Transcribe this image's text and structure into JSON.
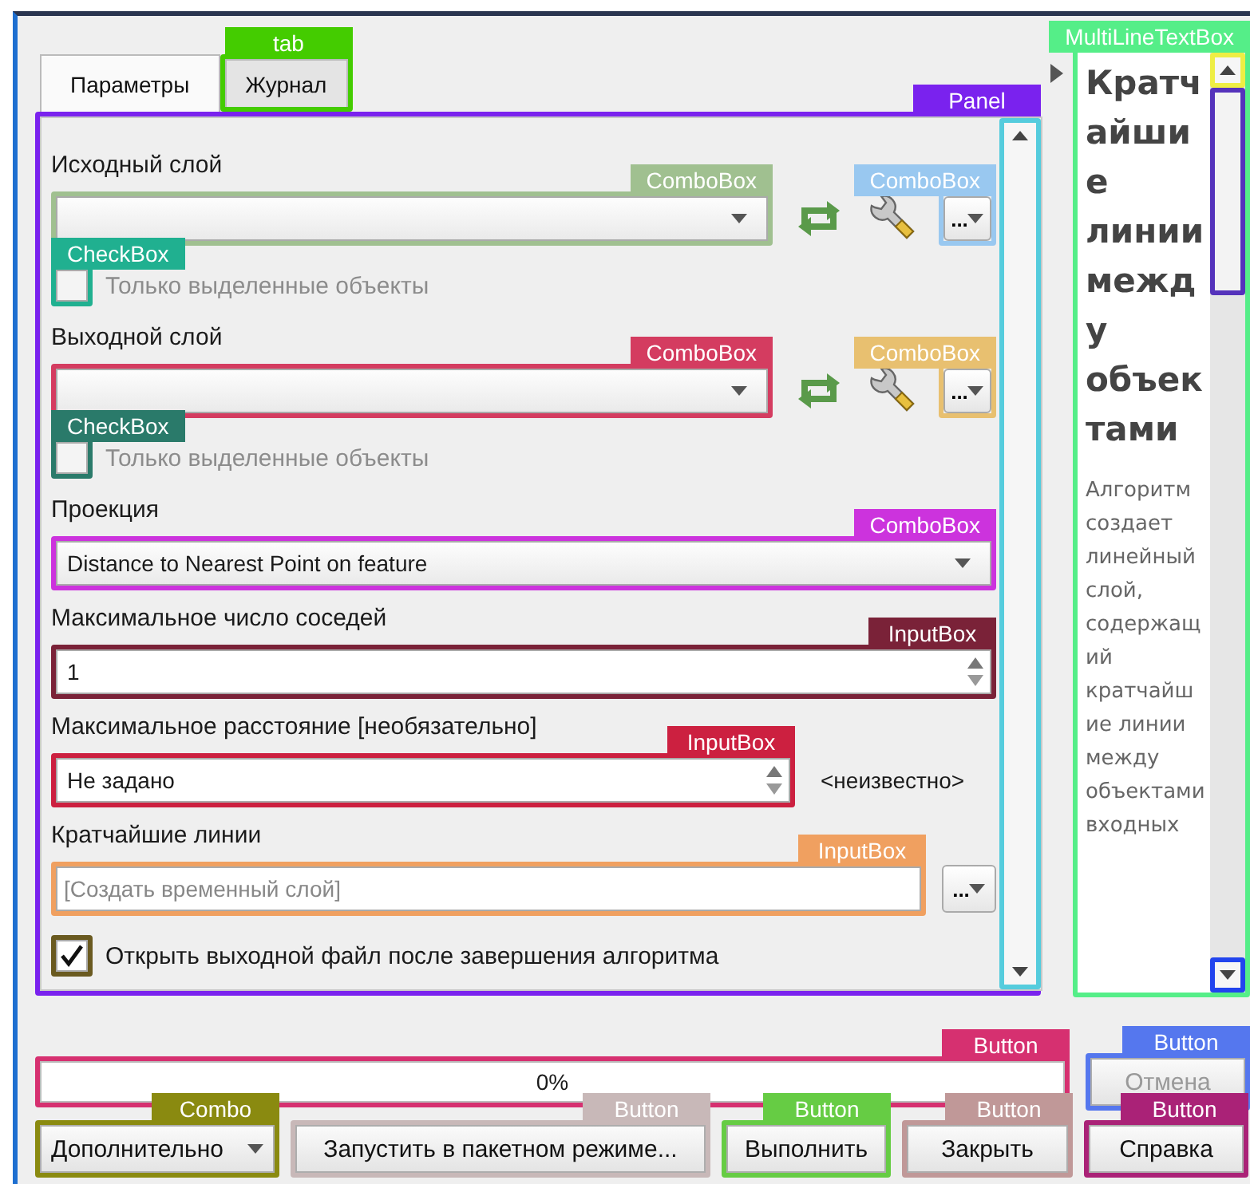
{
  "tabs": [
    {
      "label": "Параметры",
      "selected": true
    },
    {
      "label": "Журнал",
      "selected": false,
      "annotation": {
        "label": "tab",
        "color": "#44cc00"
      }
    }
  ],
  "panel": {
    "annotation": {
      "label": "Panel",
      "color": "#7a22ee"
    },
    "scrollbar_annotation": {
      "color": "#55ccdd"
    },
    "rows": [
      {
        "kind": "label",
        "text": "Исходный слой"
      },
      {
        "kind": "layer_combo",
        "annotation": {
          "label": "ComboBox",
          "color": "#a0c090"
        },
        "button": {
          "label": "...",
          "annotation": {
            "label": "ComboBox",
            "color": "#99c8f0"
          }
        }
      },
      {
        "kind": "checkbox",
        "label": "Только выделенные объекты",
        "checked": false,
        "disabled": true,
        "annotation": {
          "label": "CheckBox",
          "color": "#20b090",
          "tag_left": true
        }
      },
      {
        "kind": "label",
        "text": "Выходной слой"
      },
      {
        "kind": "layer_combo",
        "annotation": {
          "label": "ComboBox",
          "color": "#d43c60"
        },
        "button": {
          "label": "...",
          "annotation": {
            "label": "ComboBox",
            "color": "#e8c070"
          }
        }
      },
      {
        "kind": "checkbox",
        "label": "Только выделенные объекты",
        "checked": false,
        "disabled": true,
        "annotation": {
          "label": "CheckBox",
          "color": "#2a7a6a",
          "tag_left": true
        }
      },
      {
        "kind": "label",
        "text": "Проекция"
      },
      {
        "kind": "combo",
        "value": "Distance to Nearest Point on feature",
        "annotation": {
          "label": "ComboBox",
          "color": "#cc33dd"
        }
      },
      {
        "kind": "label",
        "text": "Максимальное число соседей"
      },
      {
        "kind": "spinbox",
        "value": "1",
        "annotation": {
          "label": "InputBox",
          "color": "#7a2238"
        }
      },
      {
        "kind": "label",
        "text": "Максимальное расстояние [необязательно]"
      },
      {
        "kind": "spinbox",
        "value": "Не задано",
        "unit": "<неизвестно>",
        "annotation": {
          "label": "InputBox",
          "color": "#cc2040"
        }
      },
      {
        "kind": "label",
        "text": "Кратчайшие линии"
      },
      {
        "kind": "file_field",
        "placeholder": "[Создать временный слой]",
        "button": {
          "label": "..."
        },
        "annotation": {
          "label": "InputBox",
          "color": "#f0a060"
        }
      },
      {
        "kind": "checkbox",
        "label": "Открыть выходной файл после завершения алгоритма",
        "checked": true,
        "disabled": false,
        "annotation": {
          "color": "#6a5a20"
        }
      }
    ]
  },
  "help": {
    "title": "Кратчайшие линии между объектами",
    "text": "Алгоритм создает линейный слой, содержащий кратчайшие линии между объектами входных",
    "annotation": {
      "label": "MultiLineTextBox",
      "color": "#55ee88"
    },
    "scroll_up_annotation": {
      "color": "#eeee44"
    },
    "thumb_annotation": {
      "color": "#5533bb"
    },
    "scroll_down_annotation": {
      "color": "#2244ee"
    }
  },
  "progress": {
    "level": 0,
    "text": "0%",
    "annotation": {
      "label": "Button",
      "color": "#d63070"
    }
  },
  "cancel_button": {
    "label": "Отмена",
    "disabled": true,
    "annotation": {
      "label": "Button",
      "color": "#5577ee"
    }
  },
  "buttons": [
    {
      "kind": "dropdown",
      "label": "Дополнительно",
      "annotation": {
        "label": "Combo",
        "color": "#8a8a10"
      }
    },
    {
      "kind": "push",
      "label": "Запустить в пакетном режиме...",
      "annotation": {
        "label": "Button",
        "color": "#c8b8b8"
      }
    },
    {
      "kind": "push",
      "label": "Выполнить",
      "annotation": {
        "label": "Button",
        "color": "#66cc44"
      }
    },
    {
      "kind": "push",
      "label": "Закрыть",
      "annotation": {
        "label": "Button",
        "color": "#c09898"
      }
    },
    {
      "kind": "push",
      "label": "Справка",
      "annotation": {
        "label": "Button",
        "color": "#aa2277"
      }
    }
  ]
}
